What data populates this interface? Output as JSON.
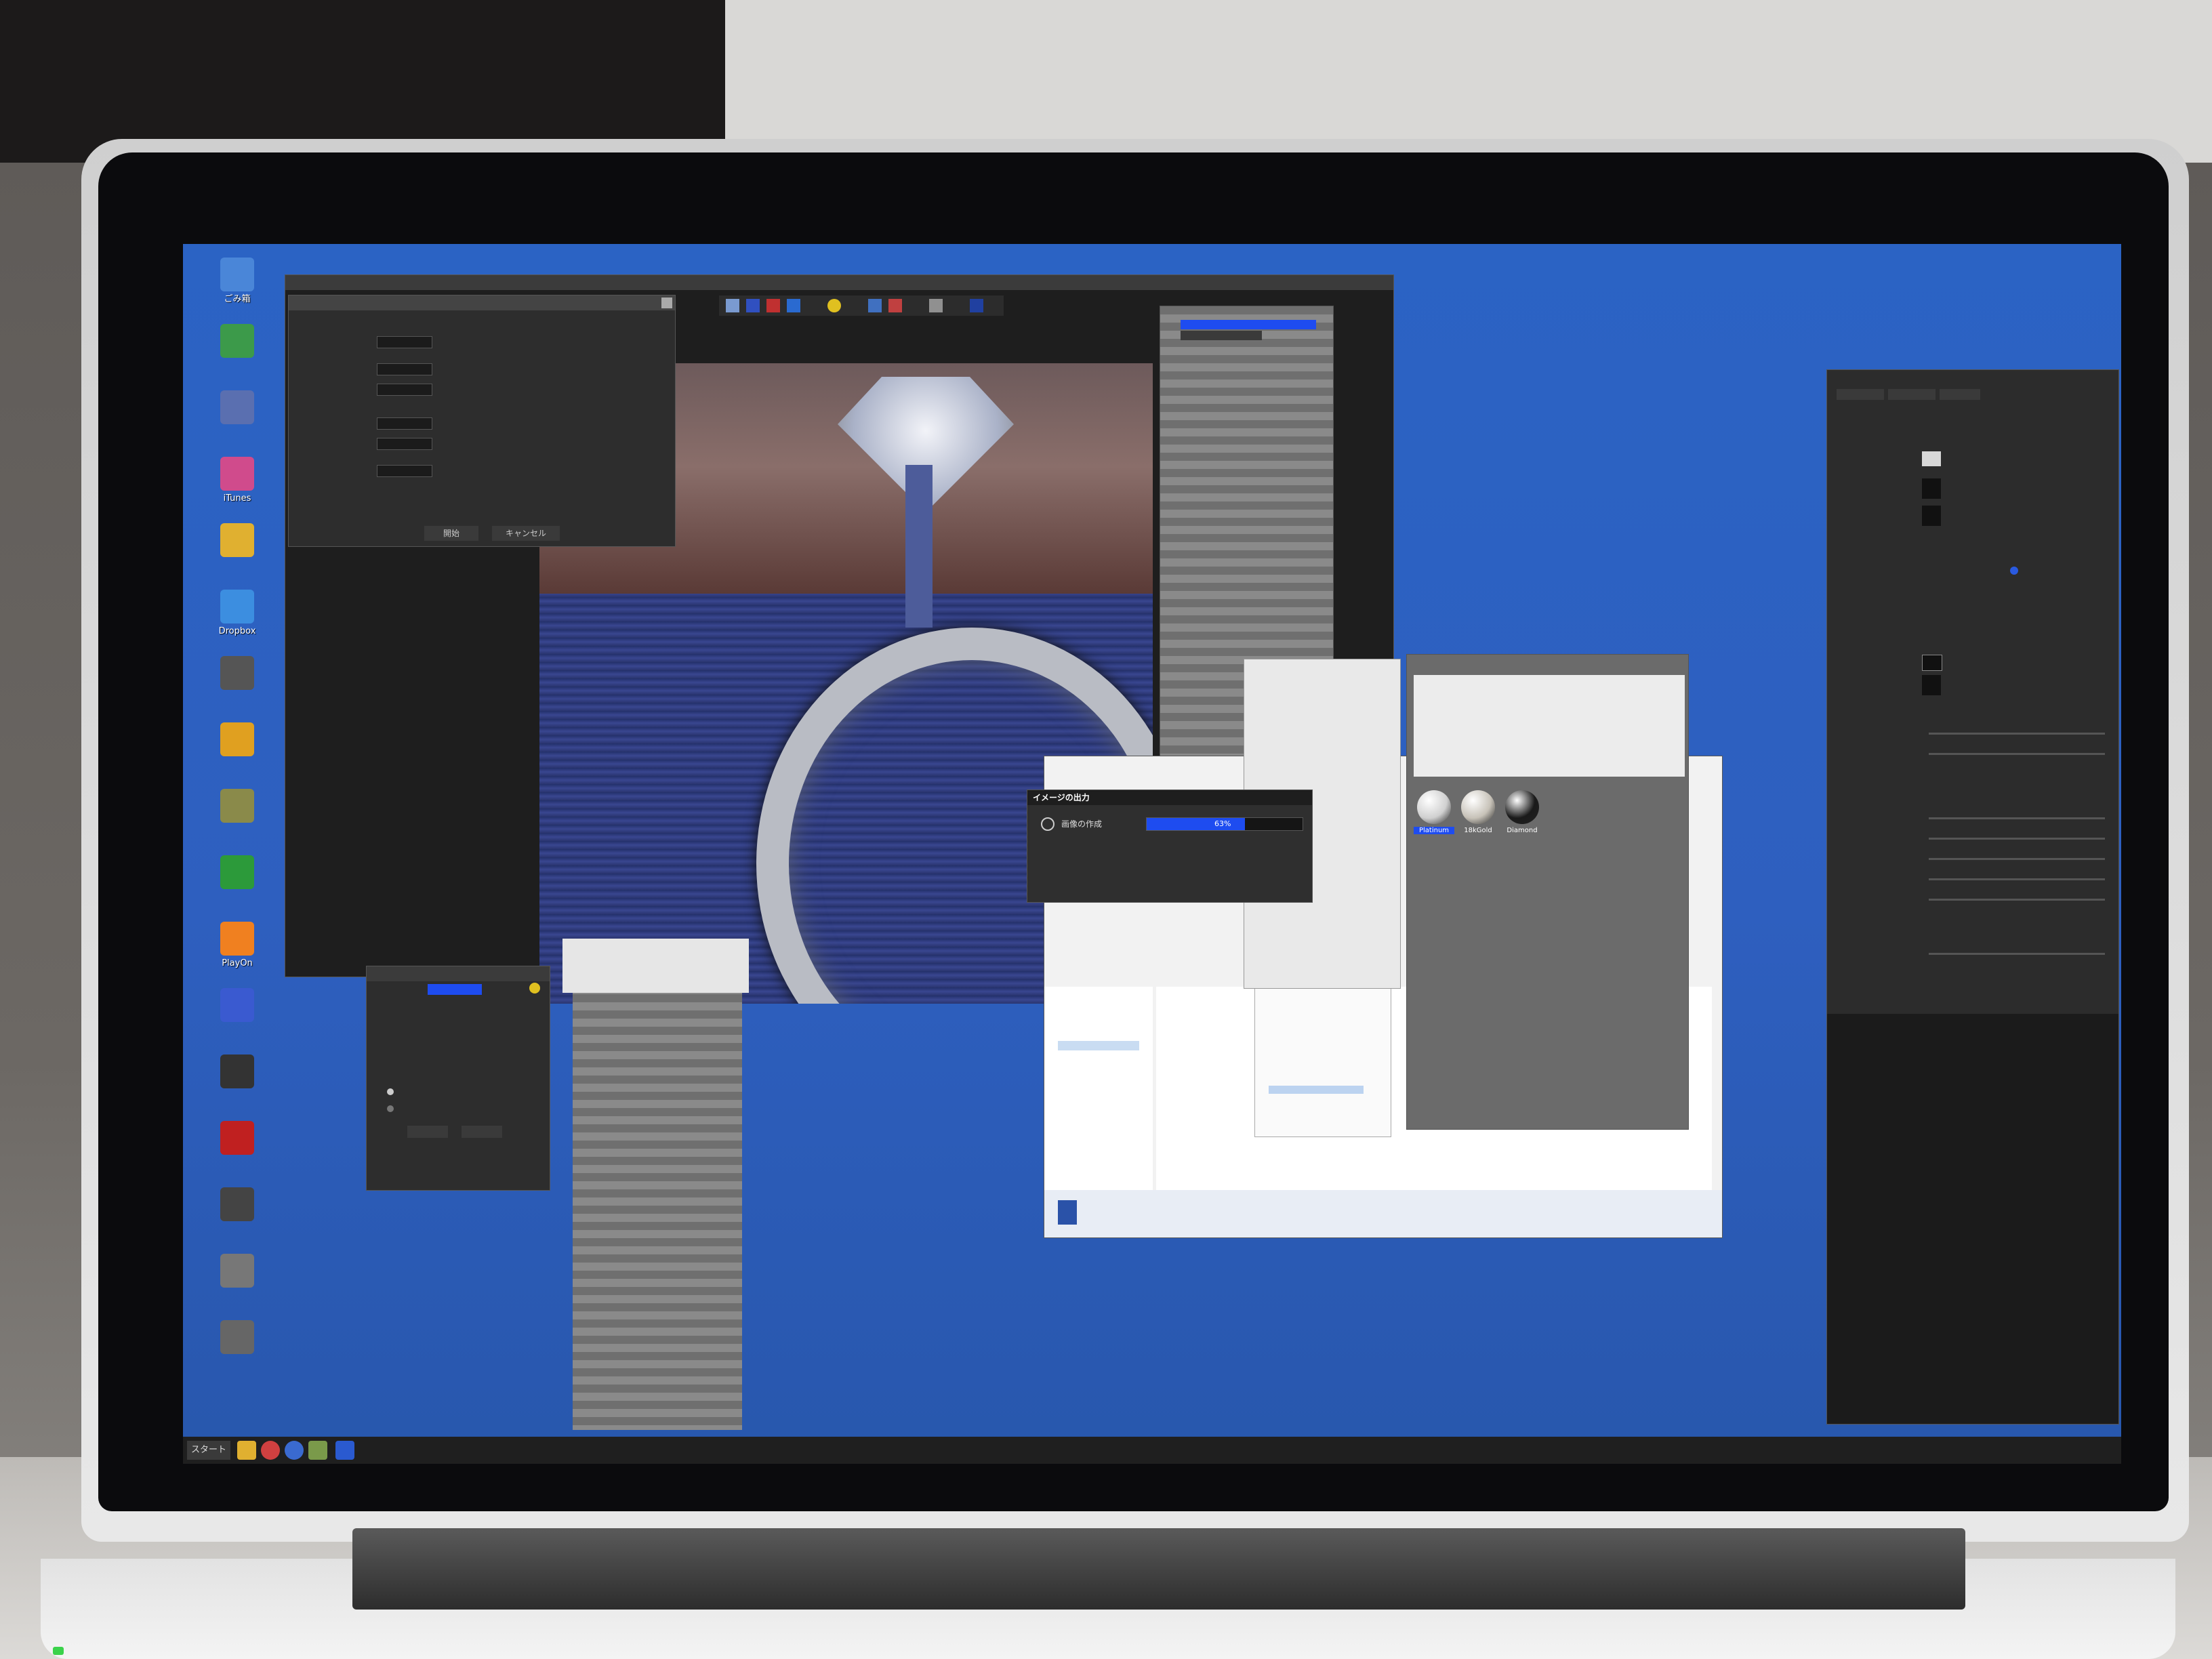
{
  "desktop": {
    "icons": [
      {
        "label": "ごみ箱",
        "color": "#4a86d8"
      },
      {
        "label": "",
        "color": "#3c9a4a"
      },
      {
        "label": "",
        "color": "#5a6fb0"
      },
      {
        "label": "iTunes",
        "color": "#d04b8c"
      },
      {
        "label": "",
        "color": "#e0b030"
      },
      {
        "label": "Dropbox",
        "color": "#3c8ee0"
      },
      {
        "label": "",
        "color": "#555555"
      },
      {
        "label": "",
        "color": "#e0a020"
      },
      {
        "label": "",
        "color": "#8a8a4a"
      },
      {
        "label": "",
        "color": "#2c9a3a"
      },
      {
        "label": "PlayOn",
        "color": "#f08020"
      },
      {
        "label": "",
        "color": "#3a5ad0"
      },
      {
        "label": "",
        "color": "#333333"
      },
      {
        "label": "",
        "color": "#c02020"
      },
      {
        "label": "",
        "color": "#444444"
      },
      {
        "label": "",
        "color": "#777777"
      },
      {
        "label": "",
        "color": "#666666"
      }
    ]
  },
  "progress_dialog": {
    "title": "イメージの出力",
    "status": "画像の作成",
    "percent_label": "63%",
    "progress": 0.63
  },
  "render_dialog": {
    "ok_label": "開始",
    "cancel_label": "キャンセル"
  },
  "material_panel": {
    "swatches": [
      {
        "label": "Platinum",
        "color": "#d0d0d0"
      },
      {
        "label": "18kGold",
        "color": "#c7c2b8"
      },
      {
        "label": "Diamond",
        "color": "#1a1a1a"
      }
    ]
  },
  "taskbar": {
    "start_label": "スタート"
  },
  "colors": {
    "desktop_blue": "#2e5fbf",
    "accent_blue": "#1e4cf0"
  }
}
